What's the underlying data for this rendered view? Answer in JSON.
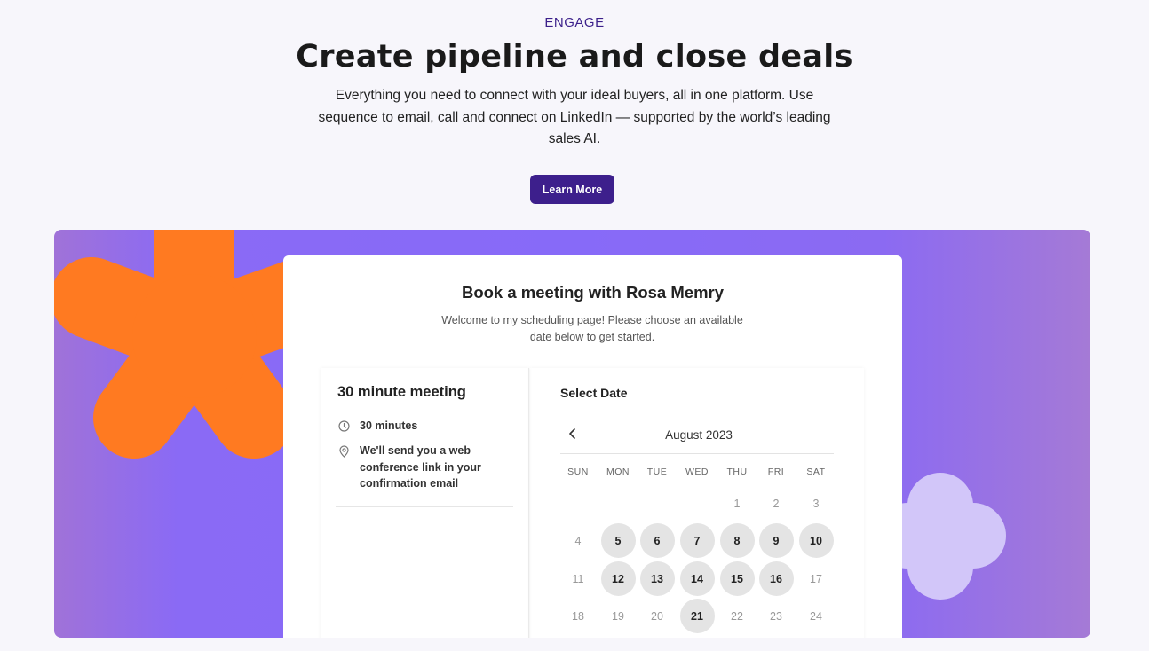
{
  "header": {
    "eyebrow": "ENGAGE",
    "title": "Create pipeline and close deals",
    "subtitle": "Everything you need to connect with your ideal buyers, all in one platform. Use sequence to email, call and connect on LinkedIn — supported by the world’s leading sales AI.",
    "cta_label": "Learn More"
  },
  "colors": {
    "accent": "#3d1f8c",
    "hero_purple": "#876af8",
    "shape_orange": "#ff7a21",
    "shape_lavender": "#d2c6f9",
    "day_available": "#e4e4e4"
  },
  "booking": {
    "title": "Book a meeting with Rosa Memry",
    "subtitle": "Welcome to my scheduling page! Please choose an available date below to get started.",
    "meeting": {
      "title": "30 minute meeting",
      "duration": "30 minutes",
      "location_note": "We'll send you a web conference link in your confirmation email",
      "duration_icon": "clock-icon",
      "location_icon": "location-pin-icon"
    },
    "calendar": {
      "heading": "Select Date",
      "month": "August 2023",
      "prev_icon": "chevron-left-icon",
      "weekdays": [
        "SUN",
        "MON",
        "TUE",
        "WED",
        "THU",
        "FRI",
        "SAT"
      ],
      "weeks": [
        [
          null,
          null,
          null,
          null,
          "1",
          "2",
          "3"
        ],
        [
          "4",
          "5",
          "6",
          "7",
          "8",
          "9",
          "10"
        ],
        [
          "11",
          "12",
          "13",
          "14",
          "15",
          "16",
          "17"
        ],
        [
          "18",
          "19",
          "20",
          "21",
          "22",
          "23",
          "24"
        ]
      ],
      "available": [
        "5",
        "6",
        "7",
        "8",
        "9",
        "10",
        "12",
        "13",
        "14",
        "15",
        "16",
        "21"
      ]
    }
  }
}
